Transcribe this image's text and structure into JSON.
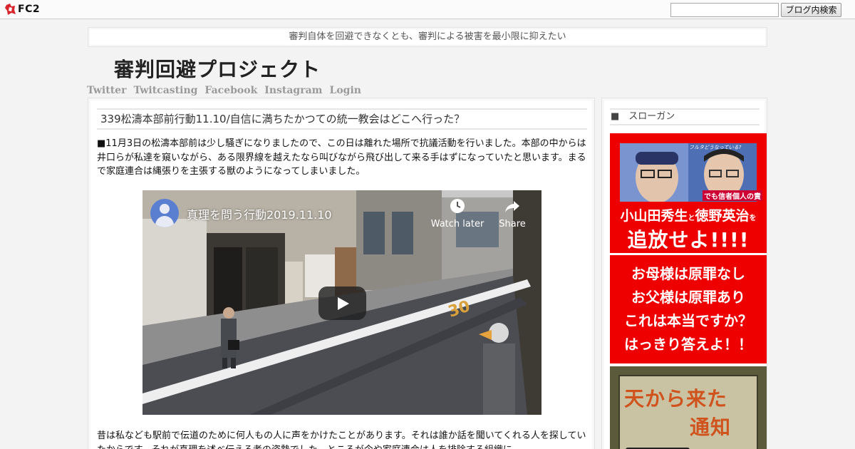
{
  "topbar": {
    "logo_text": "FC2",
    "search_placeholder": "",
    "search_button": "ブログ内検索"
  },
  "header": {
    "tagline": "審判自体を回避できなくとも、審判による被害を最小限に抑えたい",
    "title": "審判回避プロジェクト",
    "nav": [
      "Twitter",
      "Twitcasting",
      "Facebook",
      "Instagram",
      "Login"
    ]
  },
  "post": {
    "title": "339松濤本部前行動11.10/自信に満ちたかつての統一教会はどこへ行った？",
    "paragraph1": "■11月3日の松濤本部前は少し騒ぎになりましたので、この日は離れた場所で抗議活動を行いました。本部の中からは井口らが私達を窺いながら、ある限界線を越えたなら叫びながら飛び出して来る手はずになっていたと思います。まるで家庭連合は縄張りを主張する獣のようになってしまいました。",
    "paragraph2": "昔は私なども駅前で伝道のために何人もの人に声をかけたことがあります。それは誰か話を聞いてくれる人を探していたからです。それが真理を述べ伝える者の姿勢でした。ところが今や家庭連合は人を排除する組織に",
    "video": {
      "title": "真理を問う行動2019.11.10",
      "watch_later": "Watch later",
      "share": "Share",
      "road_marking": "30"
    }
  },
  "sidebar": {
    "heading": "■　スローガン",
    "banner1": {
      "tag_top": "フルタどうなっている?",
      "tag_bottom": "でも信者個人の責",
      "name_left": "小山田秀生",
      "conj": "と",
      "name_right": "徳野英治",
      "particle": "を",
      "cta": "追放せよ!!!!"
    },
    "banner2": {
      "lines": [
        "お母様は原罪なし",
        "お父様は原罪あり",
        "これは本当ですか？",
        "はっきり答えよ！！"
      ]
    },
    "banner3": {
      "line1": "天から来た",
      "line2": "通知"
    }
  },
  "colors": {
    "banner_red": "#ee0000",
    "nav_gray": "#9a9a9a",
    "page_bg": "#f3f3f3"
  }
}
